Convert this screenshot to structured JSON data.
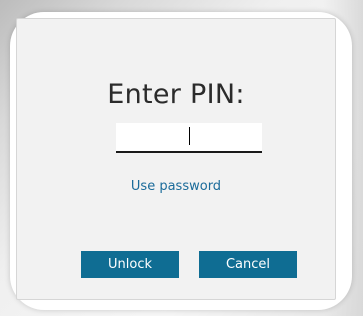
{
  "dialog": {
    "title": "Enter PIN:",
    "pin_value": "",
    "use_password_label": "Use password",
    "unlock_label": "Unlock",
    "cancel_label": "Cancel"
  },
  "colors": {
    "accent": "#0f6d93",
    "link": "#1a6b9a",
    "panel_background": "#f2f2f2"
  }
}
